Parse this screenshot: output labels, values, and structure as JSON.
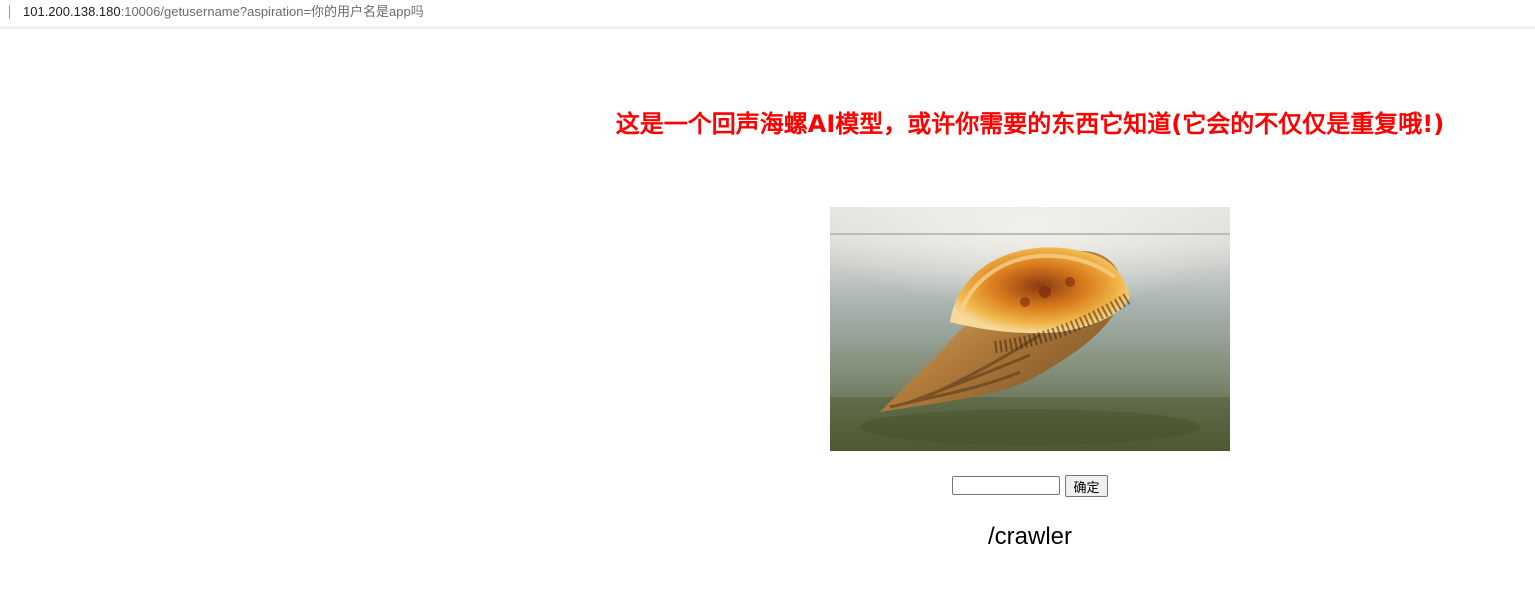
{
  "browser": {
    "url_host": "101.200.138.180",
    "url_rest": ":10006/getusername?aspiration=你的用户名是app吗"
  },
  "page": {
    "headline": "这是一个回声海螺AI模型，或许你需要的东西它知道(它会的不仅仅是重复哦!)",
    "input_value": "",
    "submit_label": "确定",
    "result_text": "/crawler"
  },
  "colors": {
    "headline": "#ff0000"
  }
}
